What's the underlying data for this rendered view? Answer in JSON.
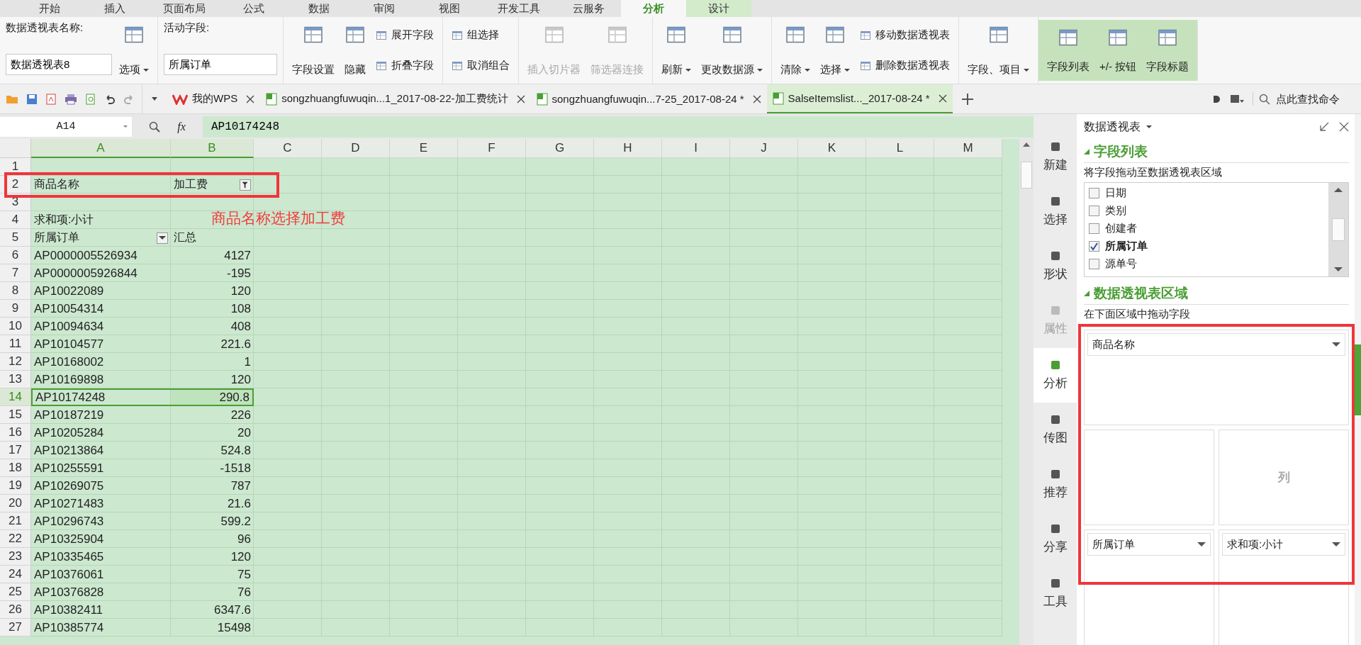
{
  "menu_tabs": [
    {
      "label": "开始",
      "selected": false,
      "contextual": false
    },
    {
      "label": "插入",
      "selected": false,
      "contextual": false
    },
    {
      "label": "页面布局",
      "selected": false,
      "contextual": false
    },
    {
      "label": "公式",
      "selected": false,
      "contextual": false
    },
    {
      "label": "数据",
      "selected": false,
      "contextual": false
    },
    {
      "label": "审阅",
      "selected": false,
      "contextual": false
    },
    {
      "label": "视图",
      "selected": false,
      "contextual": false
    },
    {
      "label": "开发工具",
      "selected": false,
      "contextual": false
    },
    {
      "label": "云服务",
      "selected": false,
      "contextual": false
    },
    {
      "label": "分析",
      "selected": true,
      "contextual": true
    },
    {
      "label": "设计",
      "selected": false,
      "contextual": true
    }
  ],
  "ribbon": {
    "pivot_name_label": "数据透视表名称:",
    "pivot_name": "数据透视表8",
    "options_button": {
      "label": "选项",
      "dropdown": true
    },
    "active_field_label": "活动字段:",
    "active_field": "所属订单",
    "groups": [
      {
        "on": false,
        "items": [
          {
            "kind": "large",
            "label": "字段设置",
            "dropdown": false,
            "disabled": false
          },
          {
            "kind": "large",
            "label": "隐藏",
            "dropdown": false,
            "disabled": false
          },
          {
            "kind": "small",
            "label": "展开字段",
            "dropdown": false,
            "disabled": false
          },
          {
            "kind": "small",
            "label": "折叠字段",
            "dropdown": false,
            "disabled": false
          }
        ]
      },
      {
        "on": false,
        "items": [
          {
            "kind": "small",
            "label": "组选择",
            "dropdown": false,
            "disabled": false
          },
          {
            "kind": "small",
            "label": "取消组合",
            "dropdown": false,
            "disabled": false
          }
        ]
      },
      {
        "on": false,
        "items": [
          {
            "kind": "large",
            "label": "插入切片器",
            "dropdown": false,
            "disabled": true
          },
          {
            "kind": "large",
            "label": "筛选器连接",
            "dropdown": false,
            "disabled": true
          }
        ]
      },
      {
        "on": false,
        "items": [
          {
            "kind": "large",
            "label": "刷新",
            "dropdown": true,
            "disabled": false
          },
          {
            "kind": "large",
            "label": "更改数据源",
            "dropdown": true,
            "disabled": false
          }
        ]
      },
      {
        "on": false,
        "items": [
          {
            "kind": "large",
            "label": "清除",
            "dropdown": true,
            "disabled": false
          },
          {
            "kind": "large",
            "label": "选择",
            "dropdown": true,
            "disabled": false
          },
          {
            "kind": "small",
            "label": "移动数据透视表",
            "dropdown": false,
            "disabled": false
          },
          {
            "kind": "small",
            "label": "删除数据透视表",
            "dropdown": false,
            "disabled": false
          }
        ]
      },
      {
        "on": false,
        "items": [
          {
            "kind": "large",
            "label": "字段、项目",
            "dropdown": true,
            "disabled": false
          }
        ]
      },
      {
        "on": true,
        "items": [
          {
            "kind": "large",
            "label": "字段列表",
            "dropdown": false,
            "disabled": false
          },
          {
            "kind": "large",
            "label": "+/- 按钮",
            "dropdown": false,
            "disabled": false
          },
          {
            "kind": "large",
            "label": "字段标题",
            "dropdown": false,
            "disabled": false
          }
        ]
      }
    ]
  },
  "doc_tabs": [
    {
      "label": "我的WPS",
      "kind": "home",
      "selected": false
    },
    {
      "label": "songzhuangfuwuqin...1_2017-08-22-加工费统计",
      "kind": "sheet",
      "selected": false
    },
    {
      "label": "songzhuangfuwuqin...7-25_2017-08-24 *",
      "kind": "sheet",
      "selected": false
    },
    {
      "label": "SalseItemslist..._2017-08-24 *",
      "kind": "sheet",
      "selected": true
    }
  ],
  "command_search": {
    "placeholder": "点此查找命令"
  },
  "formula_bar": {
    "cell": "A14",
    "fx": "fx",
    "value": "AP10174248"
  },
  "sheet": {
    "columns": [
      {
        "label": "A",
        "selected": true
      },
      {
        "label": "B",
        "selected": true
      },
      {
        "label": "C",
        "selected": false
      },
      {
        "label": "D",
        "selected": false
      },
      {
        "label": "E",
        "selected": false
      },
      {
        "label": "F",
        "selected": false
      },
      {
        "label": "G",
        "selected": false
      },
      {
        "label": "H",
        "selected": false
      },
      {
        "label": "I",
        "selected": false
      },
      {
        "label": "J",
        "selected": false
      },
      {
        "label": "K",
        "selected": false
      },
      {
        "label": "L",
        "selected": false
      },
      {
        "label": "M",
        "selected": false
      }
    ],
    "rows": [
      {
        "number": "1",
        "kind": "blank",
        "selected": false
      },
      {
        "number": "2",
        "kind": "page_field",
        "a": "商品名称",
        "b": "加工费",
        "selected": false
      },
      {
        "number": "3",
        "kind": "blank",
        "selected": false
      },
      {
        "number": "4",
        "kind": "data_label",
        "a": "求和项:小计",
        "selected": false
      },
      {
        "number": "5",
        "kind": "header",
        "a": "所属订单",
        "b": "汇总",
        "selected": false
      },
      {
        "number": "6",
        "kind": "data",
        "a": "AP0000005526934",
        "b": "4127",
        "selected": false
      },
      {
        "number": "7",
        "kind": "data",
        "a": "AP0000005926844",
        "b": "-195",
        "selected": false
      },
      {
        "number": "8",
        "kind": "data",
        "a": "AP10022089",
        "b": "120",
        "selected": false
      },
      {
        "number": "9",
        "kind": "data",
        "a": "AP10054314",
        "b": "108",
        "selected": false
      },
      {
        "number": "10",
        "kind": "data",
        "a": "AP10094634",
        "b": "408",
        "selected": false
      },
      {
        "number": "11",
        "kind": "data",
        "a": "AP10104577",
        "b": "221.6",
        "selected": false
      },
      {
        "number": "12",
        "kind": "data",
        "a": "AP10168002",
        "b": "1",
        "selected": false
      },
      {
        "number": "13",
        "kind": "data",
        "a": "AP10169898",
        "b": "120",
        "selected": false
      },
      {
        "number": "14",
        "kind": "data",
        "a": "AP10174248",
        "b": "290.8",
        "selected": true
      },
      {
        "number": "15",
        "kind": "data",
        "a": "AP10187219",
        "b": "226",
        "selected": false
      },
      {
        "number": "16",
        "kind": "data",
        "a": "AP10205284",
        "b": "20",
        "selected": false
      },
      {
        "number": "17",
        "kind": "data",
        "a": "AP10213864",
        "b": "524.8",
        "selected": false
      },
      {
        "number": "18",
        "kind": "data",
        "a": "AP10255591",
        "b": "-1518",
        "selected": false
      },
      {
        "number": "19",
        "kind": "data",
        "a": "AP10269075",
        "b": "787",
        "selected": false
      },
      {
        "number": "20",
        "kind": "data",
        "a": "AP10271483",
        "b": "21.6",
        "selected": false
      },
      {
        "number": "21",
        "kind": "data",
        "a": "AP10296743",
        "b": "599.2",
        "selected": false
      },
      {
        "number": "22",
        "kind": "data",
        "a": "AP10325904",
        "b": "96",
        "selected": false
      },
      {
        "number": "23",
        "kind": "data",
        "a": "AP10335465",
        "b": "120",
        "selected": false
      },
      {
        "number": "24",
        "kind": "data",
        "a": "AP10376061",
        "b": "75",
        "selected": false
      },
      {
        "number": "25",
        "kind": "data",
        "a": "AP10376828",
        "b": "76",
        "selected": false
      },
      {
        "number": "26",
        "kind": "data",
        "a": "AP10382411",
        "b": "6347.6",
        "selected": false
      },
      {
        "number": "27",
        "kind": "data",
        "a": "AP10385774",
        "b": "15498",
        "selected": false
      }
    ],
    "annotation": "商品名称选择加工费"
  },
  "side_tools": [
    {
      "label": "新建",
      "selected": false,
      "disabled": false
    },
    {
      "label": "选择",
      "selected": false,
      "disabled": false
    },
    {
      "label": "形状",
      "selected": false,
      "disabled": false
    },
    {
      "label": "属性",
      "selected": false,
      "disabled": true
    },
    {
      "label": "分析",
      "selected": true,
      "disabled": false
    },
    {
      "label": "传图",
      "selected": false,
      "disabled": false
    },
    {
      "label": "推荐",
      "selected": false,
      "disabled": false
    },
    {
      "label": "分享",
      "selected": false,
      "disabled": false
    },
    {
      "label": "工具",
      "selected": false,
      "disabled": false
    }
  ],
  "pane": {
    "title": "数据透视表",
    "field_section": "字段列表",
    "field_hint": "将字段拖动至数据透视表区域",
    "fields": [
      {
        "label": "日期",
        "checked": false
      },
      {
        "label": "类别",
        "checked": false
      },
      {
        "label": "创建者",
        "checked": false
      },
      {
        "label": "所属订单",
        "checked": true
      },
      {
        "label": "源单号",
        "checked": false
      }
    ],
    "area_section": "数据透视表区域",
    "area_hint": "在下面区域中拖动字段",
    "areas": [
      {
        "kind": "filter",
        "field": "商品名称"
      },
      {
        "kind": "columns",
        "placeholder": "列"
      },
      {
        "kind": "rows",
        "field": "所属订单"
      },
      {
        "kind": "values",
        "field": "求和项:小计"
      }
    ]
  }
}
